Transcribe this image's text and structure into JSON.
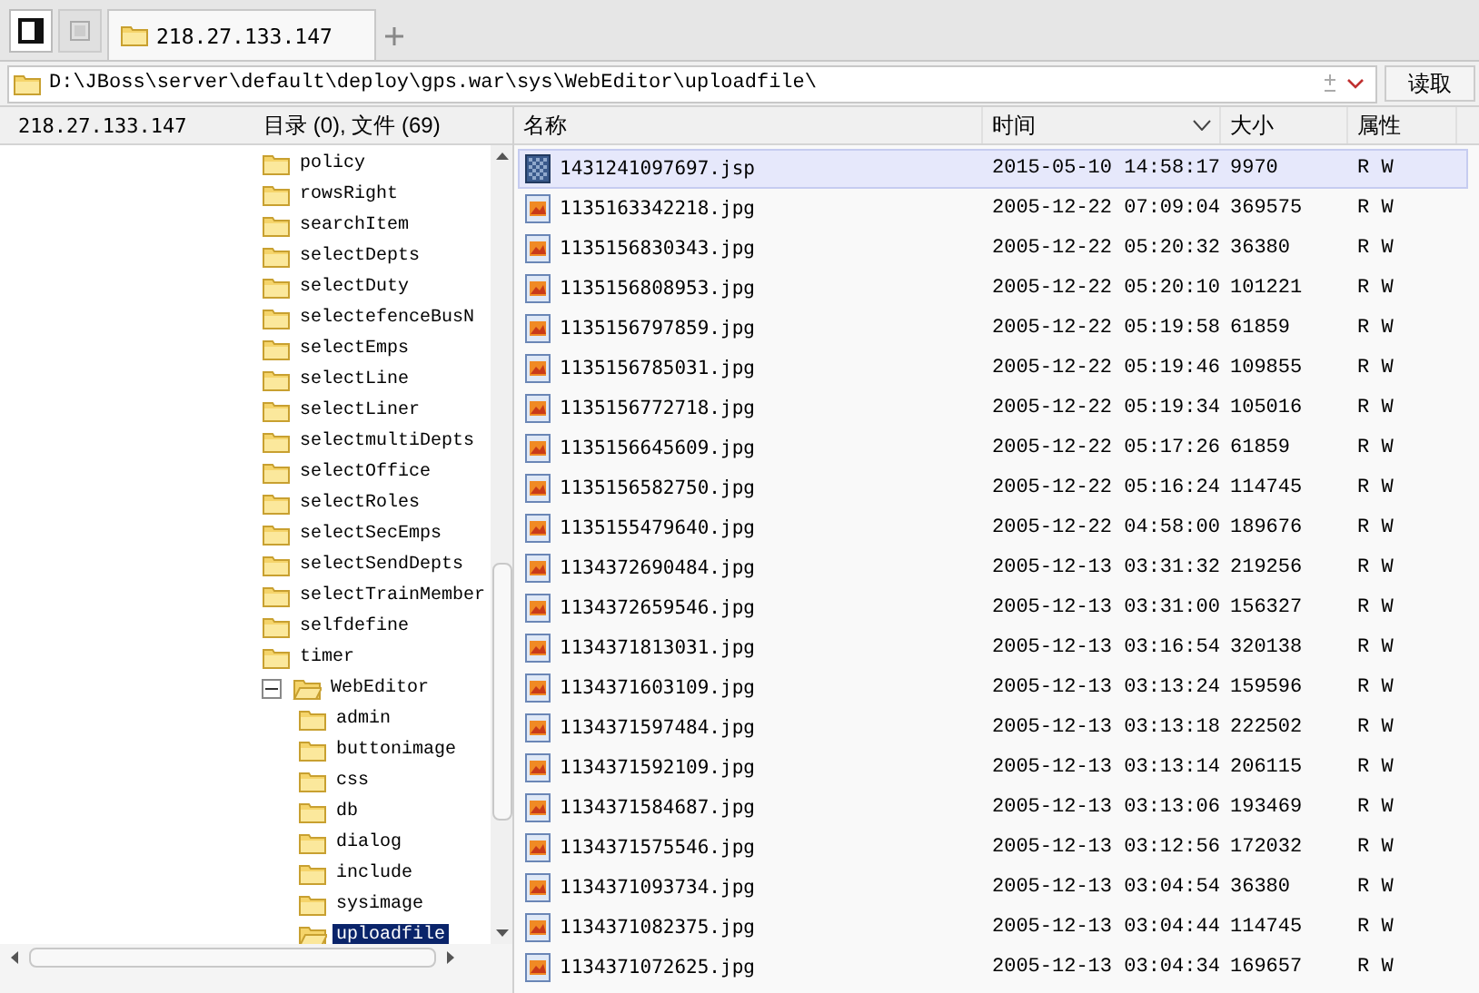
{
  "tabs": [
    {
      "label": "218.27.133.147",
      "selected": true
    }
  ],
  "address": {
    "path": "D:\\JBoss\\server\\default\\deploy\\gps.war\\sys\\WebEditor\\uploadfile\\",
    "button": "读取"
  },
  "sidebar": {
    "host": "218.27.133.147",
    "tree": [
      {
        "label": "policy",
        "selected": false
      },
      {
        "label": "rowsRight",
        "selected": false
      },
      {
        "label": "searchItem",
        "selected": false
      },
      {
        "label": "selectDepts",
        "selected": false
      },
      {
        "label": "selectDuty",
        "selected": false
      },
      {
        "label": "selectefenceBusN",
        "selected": false
      },
      {
        "label": "selectEmps",
        "selected": false
      },
      {
        "label": "selectLine",
        "selected": false
      },
      {
        "label": "selectLiner",
        "selected": false
      },
      {
        "label": "selectmultiDepts",
        "selected": false
      },
      {
        "label": "selectOffice",
        "selected": false
      },
      {
        "label": "selectRoles",
        "selected": false
      },
      {
        "label": "selectSecEmps",
        "selected": false
      },
      {
        "label": "selectSendDepts",
        "selected": false
      },
      {
        "label": "selectTrainMember",
        "selected": false
      },
      {
        "label": "selfdefine",
        "selected": false
      },
      {
        "label": "timer",
        "selected": false
      },
      {
        "label": "WebEditor",
        "selected": false,
        "expanded": true,
        "children": [
          {
            "label": "admin",
            "selected": false
          },
          {
            "label": "buttonimage",
            "selected": false
          },
          {
            "label": "css",
            "selected": false
          },
          {
            "label": "db",
            "selected": false
          },
          {
            "label": "dialog",
            "selected": false
          },
          {
            "label": "include",
            "selected": false
          },
          {
            "label": "sysimage",
            "selected": false
          },
          {
            "label": "uploadfile",
            "selected": true
          }
        ]
      }
    ]
  },
  "file_list": {
    "summary": "目录 (0), 文件 (69)",
    "columns": [
      {
        "label": "名称",
        "sorted": false
      },
      {
        "label": "时间",
        "sorted": true
      },
      {
        "label": "大小",
        "sorted": false
      },
      {
        "label": "属性",
        "sorted": false
      }
    ],
    "rows": [
      {
        "kind": "jsp",
        "name": "1431241097697.jsp",
        "time": "2015-05-10 14:58:17",
        "size": "9970",
        "attr": "R W",
        "selected": true
      },
      {
        "kind": "jpg",
        "name": "1135163342218.jpg",
        "time": "2005-12-22 07:09:04",
        "size": "369575",
        "attr": "R W",
        "selected": false
      },
      {
        "kind": "jpg",
        "name": "1135156830343.jpg",
        "time": "2005-12-22 05:20:32",
        "size": "36380",
        "attr": "R W",
        "selected": false
      },
      {
        "kind": "jpg",
        "name": "1135156808953.jpg",
        "time": "2005-12-22 05:20:10",
        "size": "101221",
        "attr": "R W",
        "selected": false
      },
      {
        "kind": "jpg",
        "name": "1135156797859.jpg",
        "time": "2005-12-22 05:19:58",
        "size": "61859",
        "attr": "R W",
        "selected": false
      },
      {
        "kind": "jpg",
        "name": "1135156785031.jpg",
        "time": "2005-12-22 05:19:46",
        "size": "109855",
        "attr": "R W",
        "selected": false
      },
      {
        "kind": "jpg",
        "name": "1135156772718.jpg",
        "time": "2005-12-22 05:19:34",
        "size": "105016",
        "attr": "R W",
        "selected": false
      },
      {
        "kind": "jpg",
        "name": "1135156645609.jpg",
        "time": "2005-12-22 05:17:26",
        "size": "61859",
        "attr": "R W",
        "selected": false
      },
      {
        "kind": "jpg",
        "name": "1135156582750.jpg",
        "time": "2005-12-22 05:16:24",
        "size": "114745",
        "attr": "R W",
        "selected": false
      },
      {
        "kind": "jpg",
        "name": "1135155479640.jpg",
        "time": "2005-12-22 04:58:00",
        "size": "189676",
        "attr": "R W",
        "selected": false
      },
      {
        "kind": "jpg",
        "name": "1134372690484.jpg",
        "time": "2005-12-13 03:31:32",
        "size": "219256",
        "attr": "R W",
        "selected": false
      },
      {
        "kind": "jpg",
        "name": "1134372659546.jpg",
        "time": "2005-12-13 03:31:00",
        "size": "156327",
        "attr": "R W",
        "selected": false
      },
      {
        "kind": "jpg",
        "name": "1134371813031.jpg",
        "time": "2005-12-13 03:16:54",
        "size": "320138",
        "attr": "R W",
        "selected": false
      },
      {
        "kind": "jpg",
        "name": "1134371603109.jpg",
        "time": "2005-12-13 03:13:24",
        "size": "159596",
        "attr": "R W",
        "selected": false
      },
      {
        "kind": "jpg",
        "name": "1134371597484.jpg",
        "time": "2005-12-13 03:13:18",
        "size": "222502",
        "attr": "R W",
        "selected": false
      },
      {
        "kind": "jpg",
        "name": "1134371592109.jpg",
        "time": "2005-12-13 03:13:14",
        "size": "206115",
        "attr": "R W",
        "selected": false
      },
      {
        "kind": "jpg",
        "name": "1134371584687.jpg",
        "time": "2005-12-13 03:13:06",
        "size": "193469",
        "attr": "R W",
        "selected": false
      },
      {
        "kind": "jpg",
        "name": "1134371575546.jpg",
        "time": "2005-12-13 03:12:56",
        "size": "172032",
        "attr": "R W",
        "selected": false
      },
      {
        "kind": "jpg",
        "name": "1134371093734.jpg",
        "time": "2005-12-13 03:04:54",
        "size": "36380",
        "attr": "R W",
        "selected": false
      },
      {
        "kind": "jpg",
        "name": "1134371082375.jpg",
        "time": "2005-12-13 03:04:44",
        "size": "114745",
        "attr": "R W",
        "selected": false
      },
      {
        "kind": "jpg",
        "name": "1134371072625.jpg",
        "time": "2005-12-13 03:04:34",
        "size": "169657",
        "attr": "R W",
        "selected": false
      }
    ]
  }
}
